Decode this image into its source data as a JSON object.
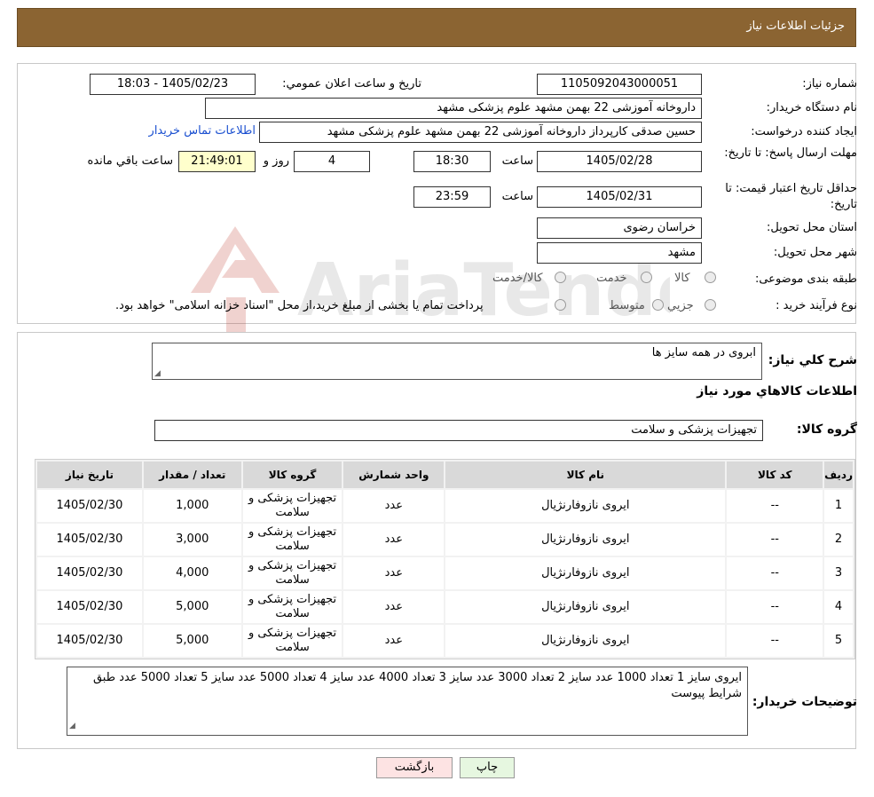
{
  "header": {
    "title": "جزئیات اطلاعات نیاز"
  },
  "form": {
    "need_number_label": "شماره نیاز:",
    "need_number": "1105092043000051",
    "announce_label": "تاریخ و ساعت اعلان عمومي:",
    "announce_value": "1405/02/23 - 18:03",
    "buyer_org_label": "نام دستگاه خریدار:",
    "buyer_org": "داروخانه آموزشی 22 بهمن مشهد   علوم پزشکی مشهد",
    "creator_label": "ایجاد کننده درخواست:",
    "creator": "حسین صدقی کارپرداز داروخانه آموزشی 22 بهمن مشهد   علوم پزشکی مشهد",
    "contact_link": "اطلاعات تماس خریدار",
    "deadline_label": "مهلت ارسال پاسخ: تا تاریخ:",
    "deadline_date": "1405/02/28",
    "time_label": "ساعت",
    "deadline_time": "18:30",
    "days_value": "4",
    "days_label": "روز و",
    "remaining_time": "21:49:01",
    "remaining_label": "ساعت باقي مانده",
    "validity_label": "حداقل تاریخ اعتبار قیمت: تا تاریخ:",
    "validity_date": "1405/02/31",
    "validity_time": "23:59",
    "province_label": "استان محل تحویل:",
    "province": "خراسان رضوی",
    "city_label": "شهر محل تحویل:",
    "city": "مشهد",
    "category_label": "طبقه بندی موضوعی:",
    "category_options": [
      "کالا",
      "خدمت",
      "کالا/خدمت"
    ],
    "process_label": "نوع فرآیند خرید :",
    "process_options": [
      "جزیي",
      "متوسط"
    ],
    "process_note": "پرداخت تمام یا بخشی از مبلغ خرید،از محل \"اسناد خزانه اسلامی\" خواهد بود."
  },
  "general": {
    "summary_label": "شرح کلي نیاز:",
    "summary": "ابروی در همه سایز ها",
    "goods_info_title": "اطلاعات کالاهاي مورد نیاز",
    "goods_group_label": "گروه کالا:",
    "goods_group": "تجهیزات پزشکی و سلامت"
  },
  "table": {
    "headers": [
      "ردیف",
      "کد کالا",
      "نام کالا",
      "واحد شمارش",
      "گروه کالا",
      "تعداد / مقدار",
      "تاریخ نیاز"
    ],
    "rows": [
      [
        "1",
        "--",
        "ایروی نازوفارنژیال",
        "عدد",
        "تجهیزات پزشکی و سلامت",
        "1,000",
        "1405/02/30"
      ],
      [
        "2",
        "--",
        "ایروی نازوفارنژیال",
        "عدد",
        "تجهیزات پزشکی و سلامت",
        "3,000",
        "1405/02/30"
      ],
      [
        "3",
        "--",
        "ایروی نازوفارنژیال",
        "عدد",
        "تجهیزات پزشکی و سلامت",
        "4,000",
        "1405/02/30"
      ],
      [
        "4",
        "--",
        "ایروی نازوفارنژیال",
        "عدد",
        "تجهیزات پزشکی و سلامت",
        "5,000",
        "1405/02/30"
      ],
      [
        "5",
        "--",
        "ایروی نازوفارنژیال",
        "عدد",
        "تجهیزات پزشکی و سلامت",
        "5,000",
        "1405/02/30"
      ]
    ]
  },
  "buyer_notes": {
    "label": "توضیحات خریدار:",
    "text": "ایروی سایز 1 تعداد 1000 عدد سایز 2 تعداد 3000 عدد سایز 3 تعداد 4000 عدد سایز 4 تعداد 5000 عدد سایز 5 تعداد 5000 عدد طبق شرایط پیوست"
  },
  "buttons": {
    "print": "چاپ",
    "back": "بازگشت"
  },
  "watermark": {
    "text": "AriaTender.neT"
  },
  "colors": {
    "header_bg": "#8b6432",
    "remaining_bg": "#ffffcc",
    "link": "#1a4fd0",
    "print_bg": "#e6f7e0",
    "back_bg": "#fde3e3"
  }
}
